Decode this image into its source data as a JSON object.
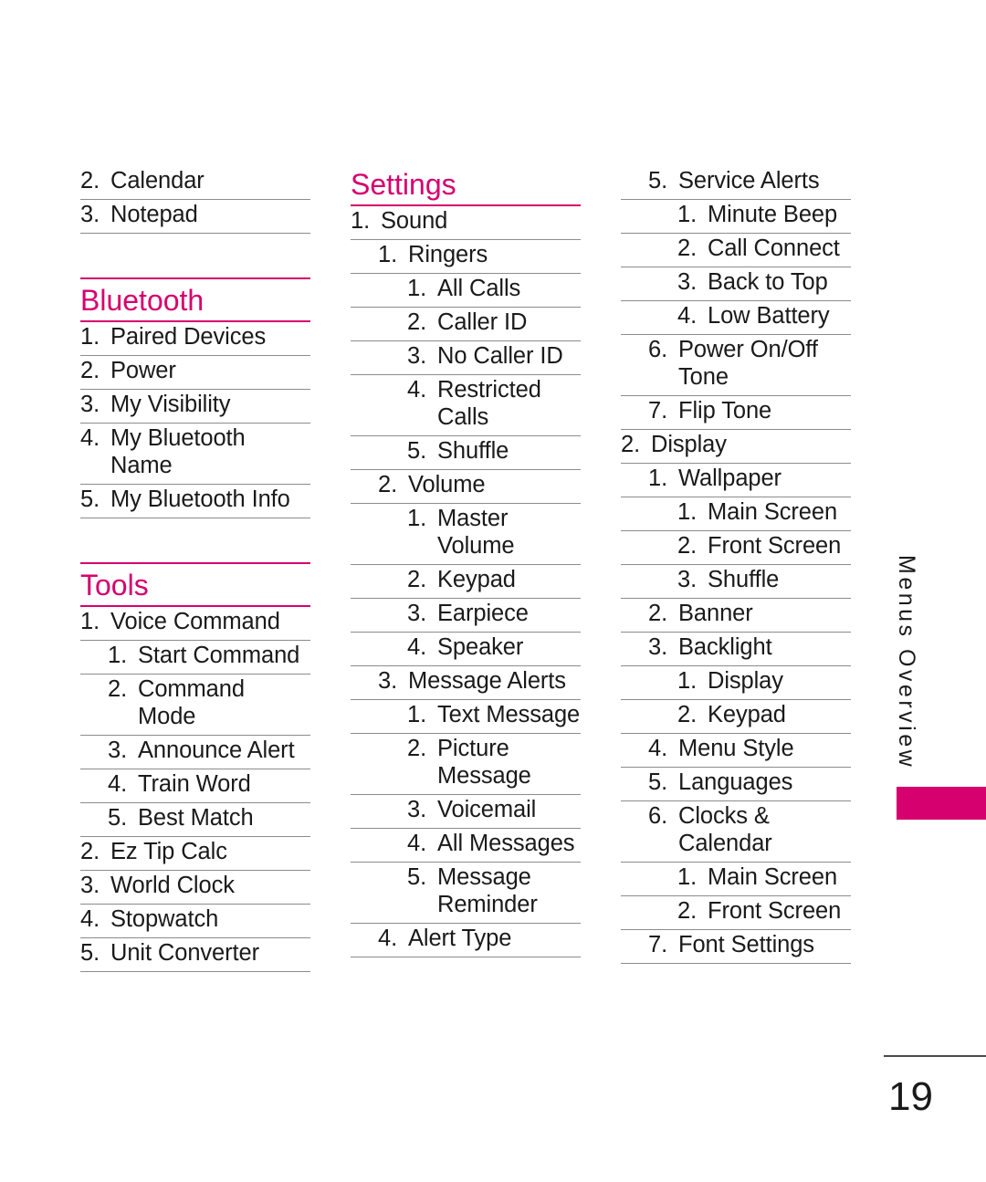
{
  "page": {
    "number": "19",
    "side_tab_label": "Menus Overview",
    "accent_color": "#d6006e",
    "rule_color": "#8c8c8c"
  },
  "columns": [
    {
      "id": "column-1",
      "blocks": [
        {
          "type": "entries",
          "items": [
            {
              "level": 1,
              "num": "2.",
              "text": "Calendar"
            },
            {
              "level": 1,
              "num": "3.",
              "text": "Notepad"
            }
          ]
        },
        {
          "type": "gap"
        },
        {
          "type": "heading",
          "title": "Bluetooth",
          "rule_above": true
        },
        {
          "type": "entries",
          "items": [
            {
              "level": 1,
              "num": "1.",
              "text": "Paired Devices"
            },
            {
              "level": 1,
              "num": "2.",
              "text": "Power"
            },
            {
              "level": 1,
              "num": "3.",
              "text": "My Visibility"
            },
            {
              "level": 1,
              "num": "4.",
              "text": "My Bluetooth\nName"
            },
            {
              "level": 1,
              "num": "5.",
              "text": "My Bluetooth Info"
            }
          ]
        },
        {
          "type": "gap"
        },
        {
          "type": "heading",
          "title": "Tools",
          "rule_above": true
        },
        {
          "type": "entries",
          "items": [
            {
              "level": 1,
              "num": "1.",
              "text": "Voice Command"
            },
            {
              "level": 2,
              "num": "1.",
              "text": "Start Command"
            },
            {
              "level": 2,
              "num": "2.",
              "text": "Command\nMode"
            },
            {
              "level": 2,
              "num": "3.",
              "text": "Announce Alert"
            },
            {
              "level": 2,
              "num": "4.",
              "text": "Train Word"
            },
            {
              "level": 2,
              "num": "5.",
              "text": "Best Match"
            },
            {
              "level": 1,
              "num": "2.",
              "text": "Ez Tip Calc"
            },
            {
              "level": 1,
              "num": "3.",
              "text": "World Clock"
            },
            {
              "level": 1,
              "num": "4.",
              "text": "Stopwatch"
            },
            {
              "level": 1,
              "num": "5.",
              "text": "Unit Converter"
            }
          ]
        }
      ]
    },
    {
      "id": "column-2",
      "blocks": [
        {
          "type": "heading",
          "title": "Settings",
          "rule_above": false
        },
        {
          "type": "entries",
          "items": [
            {
              "level": 1,
              "num": "1.",
              "text": "Sound"
            },
            {
              "level": 2,
              "num": "1.",
              "text": "Ringers"
            },
            {
              "level": 3,
              "num": "1.",
              "text": "All Calls"
            },
            {
              "level": 3,
              "num": "2.",
              "text": "Caller ID"
            },
            {
              "level": 3,
              "num": "3.",
              "text": "No Caller ID"
            },
            {
              "level": 3,
              "num": "4.",
              "text": "Restricted\nCalls"
            },
            {
              "level": 3,
              "num": "5.",
              "text": "Shuffle"
            },
            {
              "level": 2,
              "num": "2.",
              "text": "Volume"
            },
            {
              "level": 3,
              "num": "1.",
              "text": "Master\nVolume"
            },
            {
              "level": 3,
              "num": "2.",
              "text": "Keypad"
            },
            {
              "level": 3,
              "num": "3.",
              "text": "Earpiece"
            },
            {
              "level": 3,
              "num": "4.",
              "text": "Speaker"
            },
            {
              "level": 2,
              "num": "3.",
              "text": "Message Alerts"
            },
            {
              "level": 3,
              "num": "1.",
              "text": "Text Message"
            },
            {
              "level": 3,
              "num": "2.",
              "text": "Picture\nMessage"
            },
            {
              "level": 3,
              "num": "3.",
              "text": "Voicemail"
            },
            {
              "level": 3,
              "num": "4.",
              "text": "All Messages"
            },
            {
              "level": 3,
              "num": "5.",
              "text": "Message\nReminder"
            },
            {
              "level": 2,
              "num": "4.",
              "text": "Alert Type"
            }
          ]
        }
      ]
    },
    {
      "id": "column-3",
      "blocks": [
        {
          "type": "entries",
          "items": [
            {
              "level": 2,
              "num": "5.",
              "text": "Service Alerts"
            },
            {
              "level": 3,
              "num": "1.",
              "text": "Minute Beep"
            },
            {
              "level": 3,
              "num": "2.",
              "text": "Call Connect"
            },
            {
              "level": 3,
              "num": "3.",
              "text": "Back to Top"
            },
            {
              "level": 3,
              "num": "4.",
              "text": "Low Battery"
            },
            {
              "level": 2,
              "num": "6.",
              "text": "Power On/Off\nTone"
            },
            {
              "level": 2,
              "num": "7.",
              "text": "Flip Tone"
            },
            {
              "level": 1,
              "num": "2.",
              "text": "Display"
            },
            {
              "level": 2,
              "num": "1.",
              "text": "Wallpaper"
            },
            {
              "level": 3,
              "num": "1.",
              "text": "Main Screen"
            },
            {
              "level": 3,
              "num": "2.",
              "text": "Front Screen"
            },
            {
              "level": 3,
              "num": "3.",
              "text": "Shuffle"
            },
            {
              "level": 2,
              "num": "2.",
              "text": "Banner"
            },
            {
              "level": 2,
              "num": "3.",
              "text": "Backlight"
            },
            {
              "level": 3,
              "num": "1.",
              "text": "Display"
            },
            {
              "level": 3,
              "num": "2.",
              "text": "Keypad"
            },
            {
              "level": 2,
              "num": "4.",
              "text": "Menu Style"
            },
            {
              "level": 2,
              "num": "5.",
              "text": "Languages"
            },
            {
              "level": 2,
              "num": "6.",
              "text": "Clocks &\nCalendar"
            },
            {
              "level": 3,
              "num": "1.",
              "text": "Main Screen"
            },
            {
              "level": 3,
              "num": "2.",
              "text": "Front Screen"
            },
            {
              "level": 2,
              "num": "7.",
              "text": "Font Settings"
            }
          ]
        }
      ]
    }
  ]
}
